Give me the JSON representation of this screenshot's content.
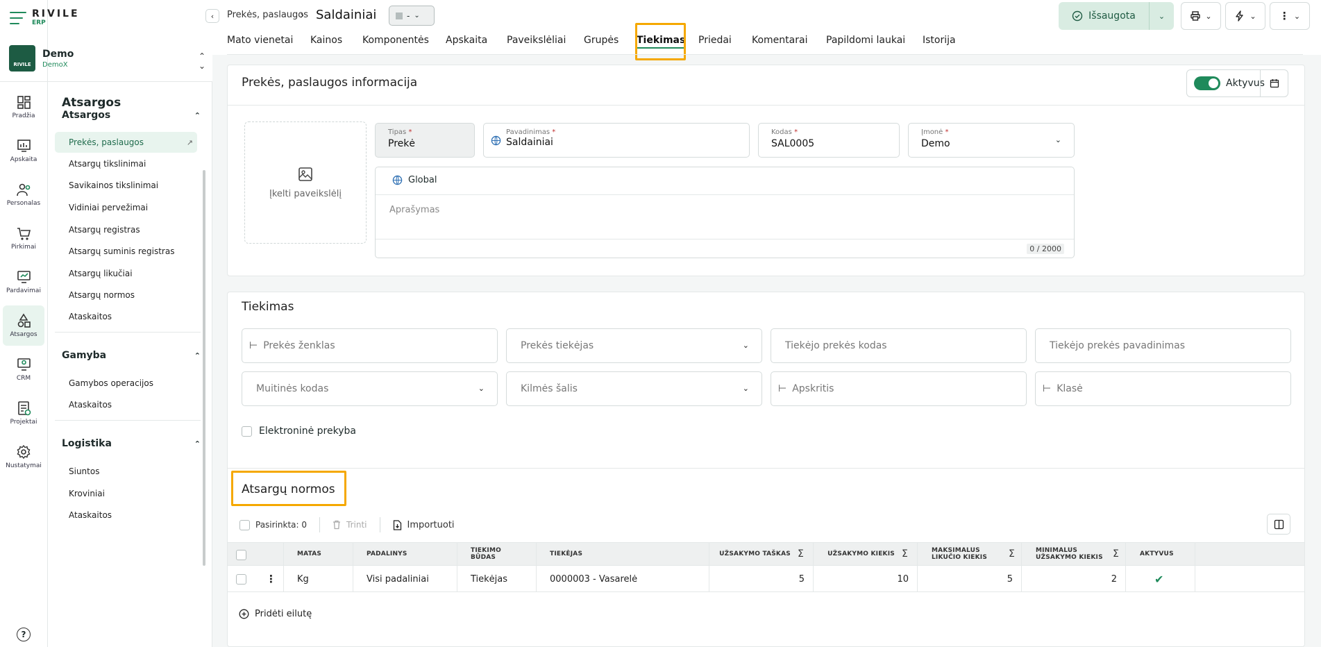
{
  "brand": {
    "name": "RIVILE",
    "sub": "ERP"
  },
  "company": {
    "name": "Demo",
    "sub": "DemoX",
    "avatar_text": "RIVILE"
  },
  "rail": [
    {
      "label": "Pradžia",
      "icon": "dashboard-icon"
    },
    {
      "label": "Apskaita",
      "icon": "chart-icon"
    },
    {
      "label": "Personalas",
      "icon": "people-icon"
    },
    {
      "label": "Pirkimai",
      "icon": "cart-icon"
    },
    {
      "label": "Pardavimai",
      "icon": "sales-icon"
    },
    {
      "label": "Atsargos",
      "icon": "shapes-icon",
      "active": true
    },
    {
      "label": "CRM",
      "icon": "crm-icon"
    },
    {
      "label": "Projektai",
      "icon": "projects-icon"
    },
    {
      "label": "Nustatymai",
      "icon": "settings-icon"
    }
  ],
  "sidebar": {
    "title": "Atsargos",
    "groups": [
      {
        "title": "Atsargos",
        "items": [
          "Prekės, paslaugos",
          "Atsargų tikslinimai",
          "Savikainos tikslinimai",
          "Vidiniai pervežimai",
          "Atsargų registras",
          "Atsargų suminis registras",
          "Atsargų likučiai",
          "Atsargų normos",
          "Ataskaitos"
        ]
      },
      {
        "title": "Gamyba",
        "items": [
          "Gamybos operacijos",
          "Ataskaitos"
        ]
      },
      {
        "title": "Logistika",
        "items": [
          "Siuntos",
          "Kroviniai",
          "Ataskaitos"
        ]
      }
    ]
  },
  "header": {
    "breadcrumb": "Prekės, paslaugos",
    "title": "Saldainiai",
    "status_value": "-",
    "saved_label": "Išsaugota"
  },
  "tabs": [
    "Mato vienetai",
    "Kainos",
    "Komponentės",
    "Apskaita",
    "Paveikslėliai",
    "Grupės",
    "Tiekimas",
    "Priedai",
    "Komentarai",
    "Papildomi laukai",
    "Istorija"
  ],
  "active_tab": "Tiekimas",
  "info": {
    "title": "Prekės, paslaugos informacija",
    "active_label": "Aktyvus",
    "active": true,
    "upload_label": "Įkelti paveikslėlį",
    "type": {
      "label": "Tipas",
      "value": "Prekė"
    },
    "name": {
      "label": "Pavadinimas",
      "value": "Saldainiai"
    },
    "code": {
      "label": "Kodas",
      "value": "SAL0005"
    },
    "company": {
      "label": "Įmonė",
      "value": "Demo"
    },
    "lang": "Global",
    "description_placeholder": "Aprašymas",
    "counter": "0 / 2000"
  },
  "supply": {
    "title": "Tiekimas",
    "fields": [
      "Prekės ženklas",
      "Prekės tiekėjas",
      "Tiekėjo prekės kodas",
      "Tiekėjo prekės pavadinimas",
      "Muitinės kodas",
      "Kilmės šalis",
      "Apskritis",
      "Klasė"
    ],
    "ecommerce_label": "Elektroninė prekyba"
  },
  "norms": {
    "title": "Atsargų normos",
    "selected_label": "Pasirinkta: 0",
    "delete_label": "Trinti",
    "import_label": "Importuoti",
    "columns": [
      "MATAS",
      "PADALINYS",
      "TIEKIMO BŪDAS",
      "TIEKĖJAS",
      "UŽSAKYMO TAŠKAS",
      "UŽSAKYMO KIEKIS",
      "MAKSIMALUS LIKUČIO KIEKIS",
      "MINIMALUS UŽSAKYMO KIEKIS",
      "AKTYVUS"
    ],
    "rows": [
      {
        "matas": "Kg",
        "padalinys": "Visi padaliniai",
        "budas": "Tiekėjas",
        "tiekejas": "0000003 - Vasarelė",
        "taskas": "5",
        "kiekis": "10",
        "max": "5",
        "min": "2",
        "aktyvus": true
      }
    ],
    "add_row_label": "Pridėti eilutę"
  },
  "colors": {
    "accent": "#1f8a5b",
    "highlight": "#f5a800",
    "saved_bg": "#d9ece2"
  }
}
